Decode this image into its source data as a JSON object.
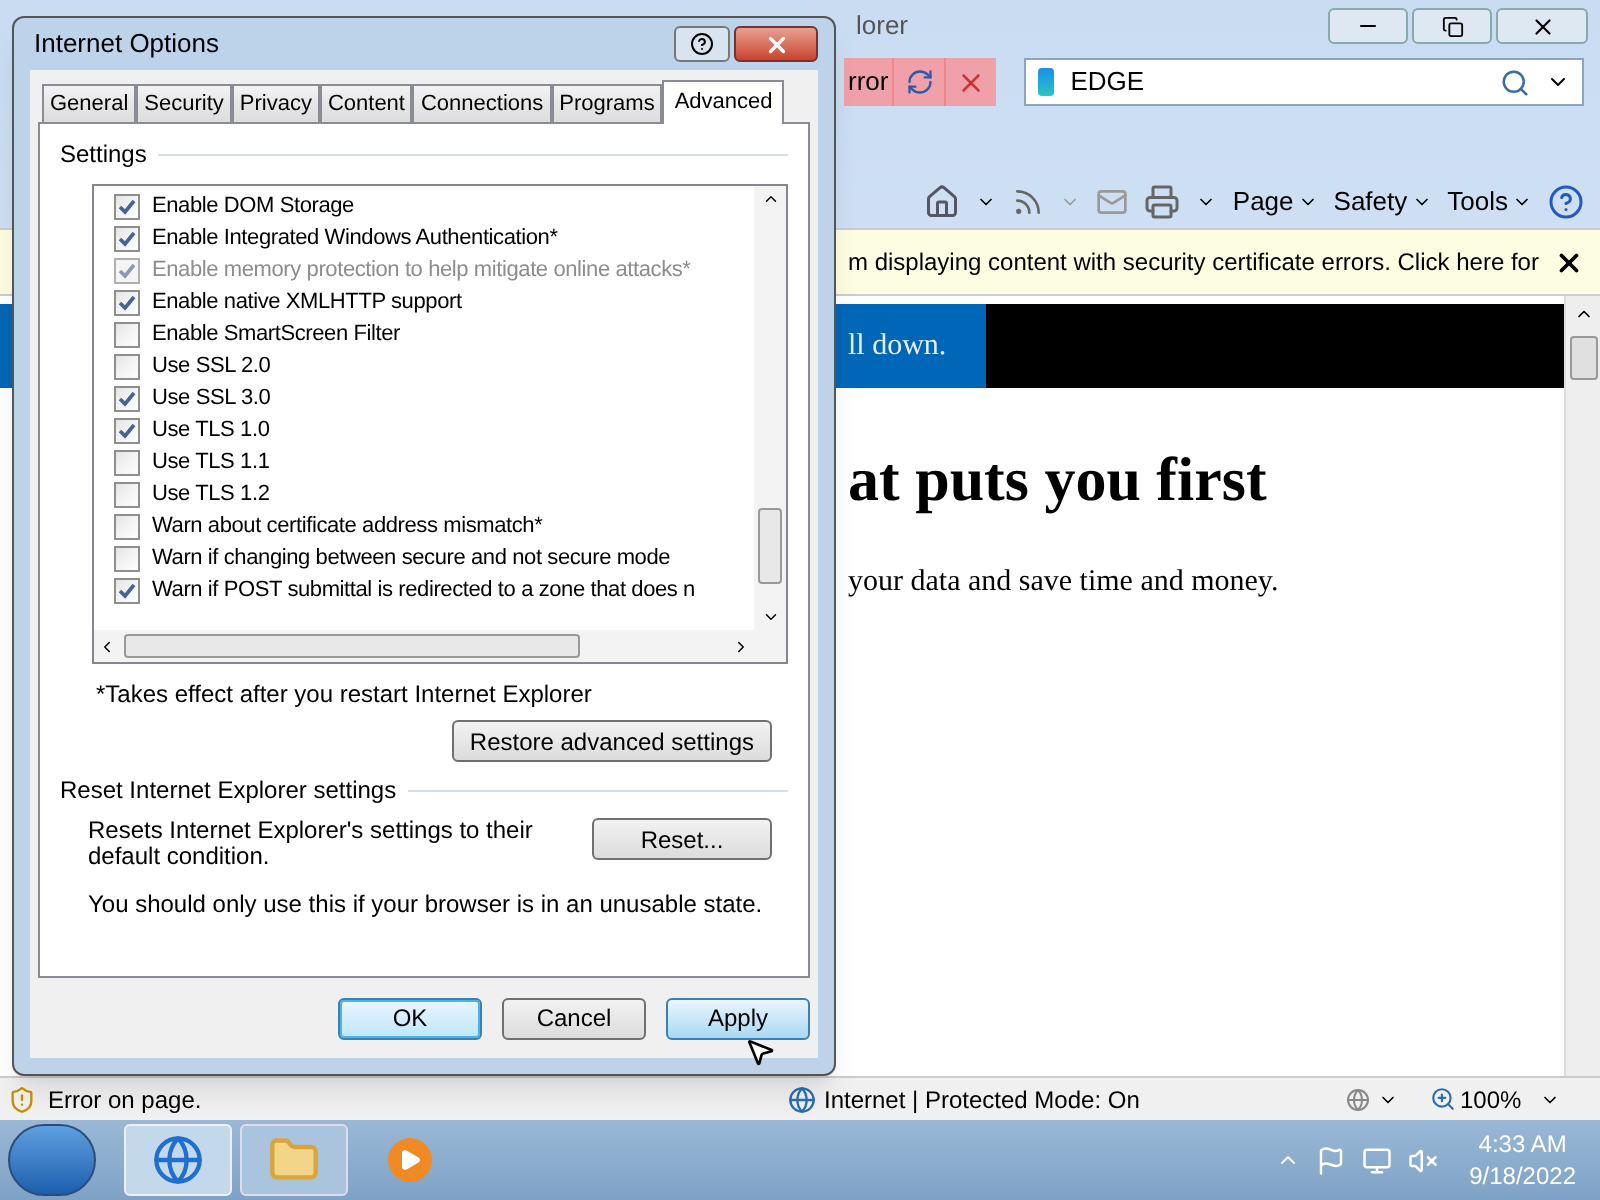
{
  "browser": {
    "title_fragment": "lorer",
    "tab_fragment": "rror",
    "search": {
      "value": "EDGE"
    },
    "command_bar": [
      {
        "label": "Page"
      },
      {
        "label": "Safety"
      },
      {
        "label": "Tools"
      }
    ],
    "info_bar": {
      "text": "m displaying content with security certificate errors. Click here for"
    },
    "page": {
      "banner": "ll down.",
      "heading": "at puts you first",
      "paragraph": "your data and save time and money."
    }
  },
  "dialog": {
    "title": "Internet Options",
    "tabs": [
      {
        "label": "General",
        "selected": false
      },
      {
        "label": "Security",
        "selected": false
      },
      {
        "label": "Privacy",
        "selected": false
      },
      {
        "label": "Content",
        "selected": false
      },
      {
        "label": "Connections",
        "selected": false
      },
      {
        "label": "Programs",
        "selected": false
      },
      {
        "label": "Advanced",
        "selected": true
      }
    ],
    "settings_label": "Settings",
    "settings": [
      {
        "label": "Enable DOM Storage",
        "checked": true,
        "disabled": false
      },
      {
        "label": "Enable Integrated Windows Authentication*",
        "checked": true,
        "disabled": false
      },
      {
        "label": "Enable memory protection to help mitigate online attacks*",
        "checked": true,
        "disabled": true
      },
      {
        "label": "Enable native XMLHTTP support",
        "checked": true,
        "disabled": false
      },
      {
        "label": "Enable SmartScreen Filter",
        "checked": false,
        "disabled": false
      },
      {
        "label": "Use SSL 2.0",
        "checked": false,
        "disabled": false
      },
      {
        "label": "Use SSL 3.0",
        "checked": true,
        "disabled": false
      },
      {
        "label": "Use TLS 1.0",
        "checked": true,
        "disabled": false
      },
      {
        "label": "Use TLS 1.1",
        "checked": false,
        "disabled": false
      },
      {
        "label": "Use TLS 1.2",
        "checked": false,
        "disabled": false
      },
      {
        "label": "Warn about certificate address mismatch*",
        "checked": false,
        "disabled": false
      },
      {
        "label": "Warn if changing between secure and not secure mode",
        "checked": false,
        "disabled": false
      },
      {
        "label": "Warn if POST submittal is redirected to a zone that does n",
        "checked": true,
        "disabled": false
      }
    ],
    "note": "*Takes effect after you restart Internet Explorer",
    "restore_button": "Restore advanced settings",
    "reset_group": "Reset Internet Explorer settings",
    "reset_description": "Resets Internet Explorer's settings to their default condition.",
    "reset_button": "Reset...",
    "warning": "You should only use this if your browser is in an unusable state.",
    "buttons": [
      {
        "label": "OK",
        "kind": "default"
      },
      {
        "label": "Cancel",
        "kind": "normal"
      },
      {
        "label": "Apply",
        "kind": "hot"
      }
    ]
  },
  "status_bar": {
    "error": "Error on page.",
    "zone": "Internet | Protected Mode: On",
    "zoom": "100%"
  },
  "taskbar": {
    "time": "4:33 AM",
    "date": "9/18/2022"
  }
}
